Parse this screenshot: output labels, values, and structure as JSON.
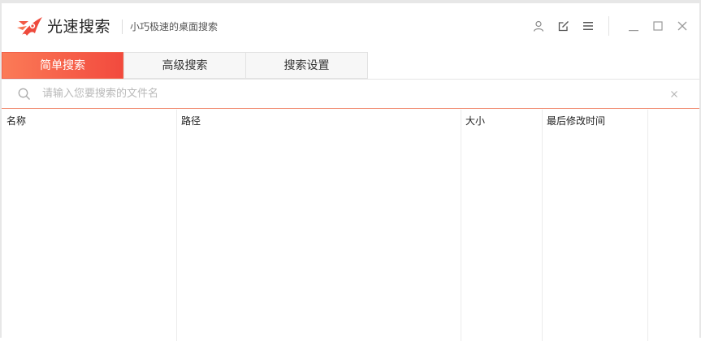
{
  "app": {
    "name": "光速搜索",
    "tagline": "小巧极速的桌面搜索"
  },
  "titlebar": {
    "icons": [
      "user-icon",
      "edit-icon",
      "menu-icon",
      "minimize-icon",
      "maximize-icon",
      "close-icon"
    ]
  },
  "tabs": [
    {
      "label": "简单搜索",
      "active": true
    },
    {
      "label": "高级搜索",
      "active": false
    },
    {
      "label": "搜索设置",
      "active": false
    }
  ],
  "search": {
    "placeholder": "请输入您要搜索的文件名",
    "value": "",
    "clear_symbol": "×"
  },
  "table": {
    "columns": [
      "名称",
      "路径",
      "大小",
      "最后修改时间"
    ],
    "rows": []
  },
  "colors": {
    "accent_start": "#fb7b57",
    "accent_end": "#f24a3e",
    "search_underline": "#f0866a"
  }
}
